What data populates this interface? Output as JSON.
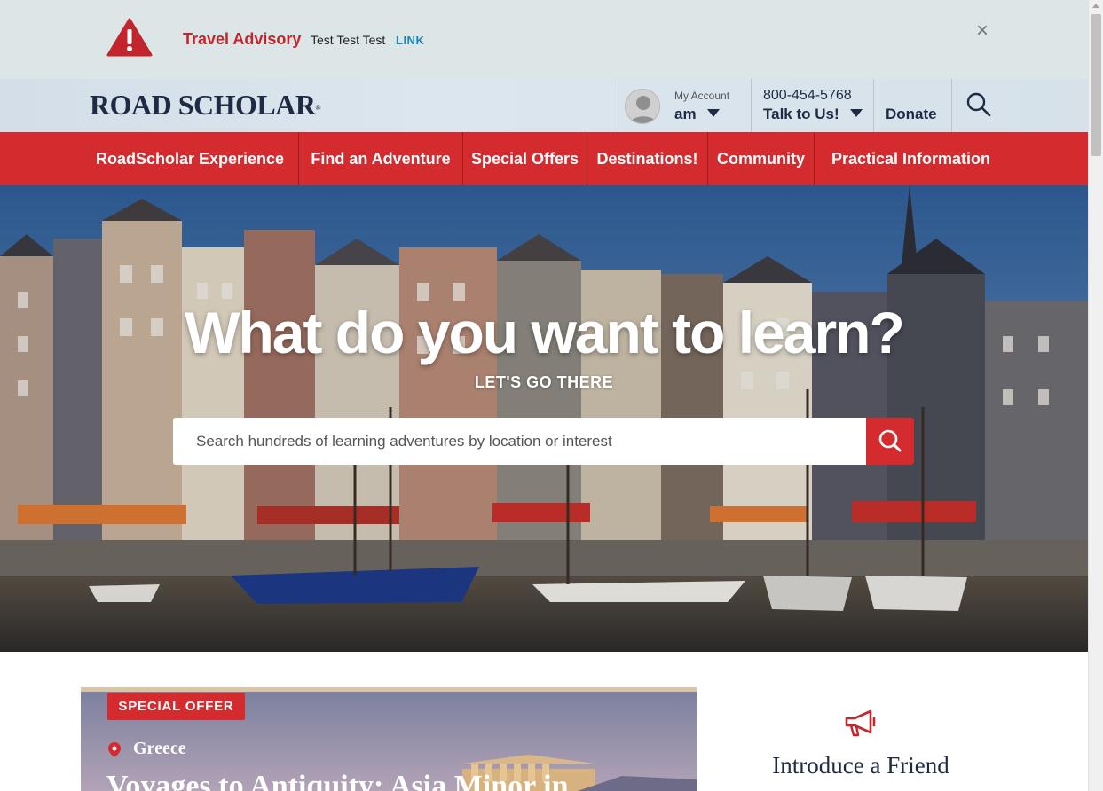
{
  "advisory": {
    "title": "Travel Advisory",
    "text": "Test Test Test",
    "link": "LINK",
    "close": "×",
    "icon": "warning-triangle-icon",
    "color": "#c4242b"
  },
  "header": {
    "logo": "ROAD SCHOLAR",
    "logo_mark": "®",
    "account": {
      "label": "My Account",
      "name": "am"
    },
    "phone": {
      "number": "800-454-5768",
      "label": "Talk to Us!"
    },
    "donate": "Donate",
    "search_icon": "search-icon"
  },
  "nav": {
    "color": "#d42b2f",
    "items": [
      {
        "label": "RoadScholar Experience"
      },
      {
        "label": "Find an Adventure"
      },
      {
        "label": "Special Offers"
      },
      {
        "label": "Destinations!"
      },
      {
        "label": "Community"
      },
      {
        "label": "Practical Information"
      }
    ]
  },
  "hero": {
    "title": "What do you want to learn?",
    "subtitle": "LET'S GO THERE",
    "search_placeholder": "Search hundreds of learning adventures by location or interest",
    "search_icon": "search-icon"
  },
  "offer": {
    "badge": "SPECIAL OFFER",
    "location": "Greece",
    "title": "Voyages to Antiquity: Asia Minor in"
  },
  "friend": {
    "icon": "megaphone-icon",
    "title": "Introduce a Friend"
  }
}
